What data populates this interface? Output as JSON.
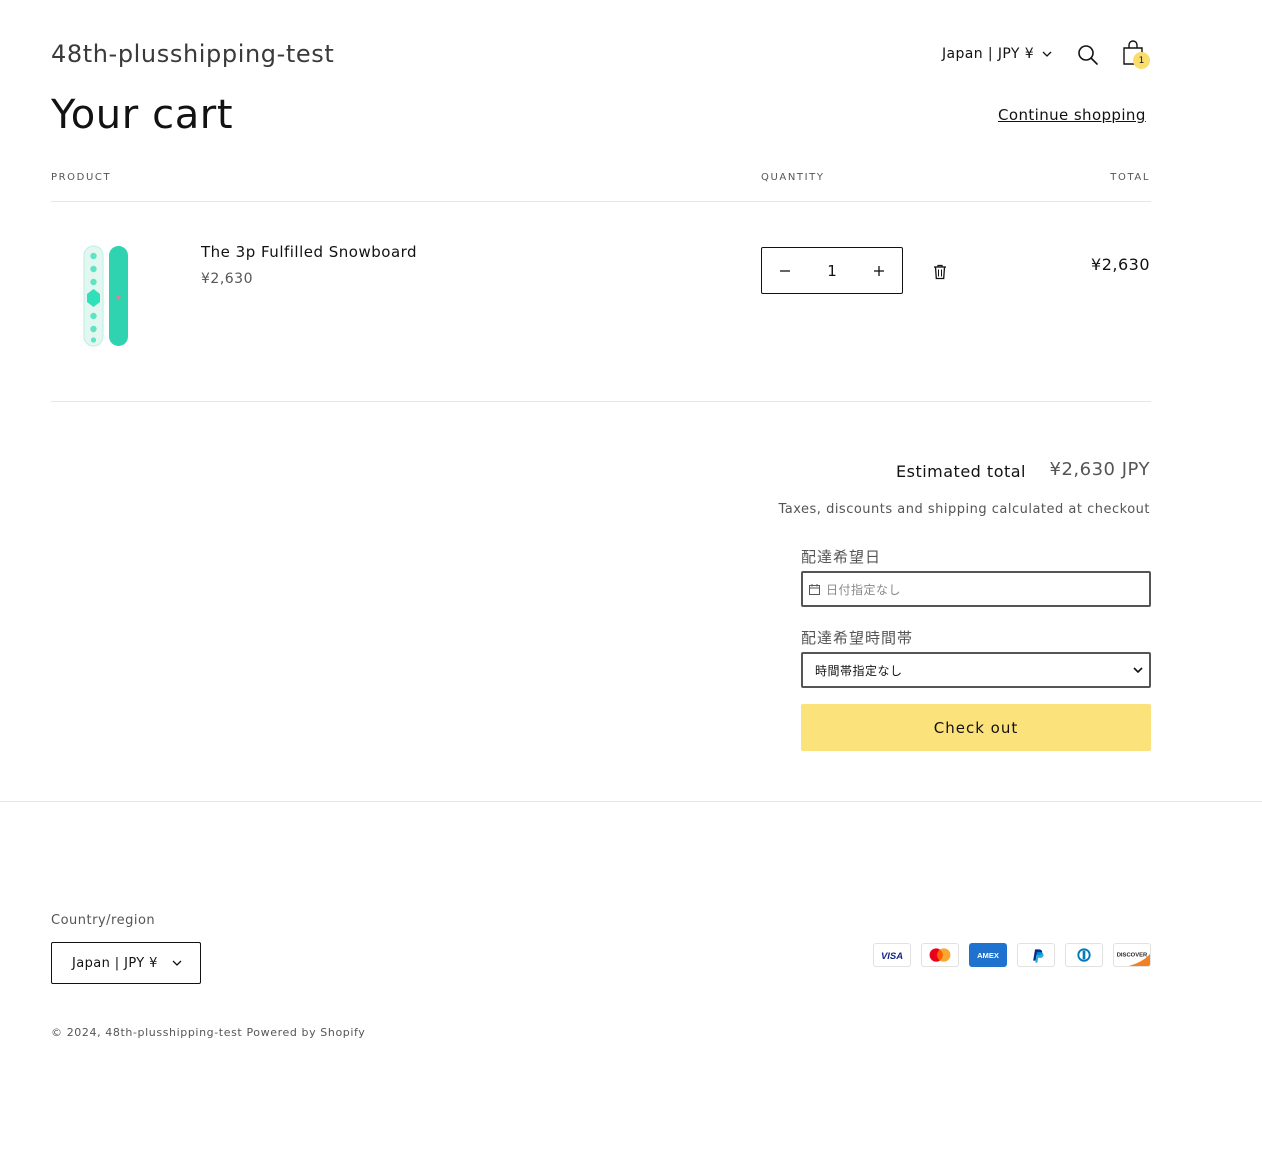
{
  "header": {
    "store_name": "48th-plusshipping-test",
    "locale": "Japan | JPY ¥",
    "cart_count": "1"
  },
  "cart": {
    "title": "Your cart",
    "continue_label": "Continue shopping",
    "columns": {
      "product": "PRODUCT",
      "quantity": "QUANTITY",
      "total": "TOTAL"
    },
    "items": [
      {
        "title": "The 3p Fulfilled Snowboard",
        "price": "¥2,630",
        "quantity": "1",
        "line_total": "¥2,630"
      }
    ]
  },
  "summary": {
    "estimated_label": "Estimated total",
    "estimated_value": "¥2,630 JPY",
    "tax_note": "Taxes, discounts and shipping calculated at checkout",
    "delivery_date_label": "配達希望日",
    "delivery_date_placeholder": "日付指定なし",
    "delivery_time_label": "配達希望時間帯",
    "delivery_time_value": "時間帯指定なし",
    "checkout_label": "Check out"
  },
  "footer": {
    "region_label": "Country/region",
    "region_value": "Japan | JPY ¥",
    "payment_icons": [
      "visa-icon",
      "mastercard-icon",
      "amex-icon",
      "paypal-icon",
      "diners-icon",
      "discover-icon"
    ],
    "payment_text": {
      "visa": "VISA",
      "amex": "AMEX",
      "discover": "DISCOVER"
    },
    "copyright_prefix": "© 2024, ",
    "copyright_store": "48th-plusshipping-test",
    "powered_by": "Powered by Shopify"
  },
  "colors": {
    "accent": "#fbe27b",
    "badge": "#f9de6d",
    "text": "#121212",
    "muted": "#555555",
    "border": "#e6e6e6",
    "snowboard": "#2fd3b0"
  }
}
